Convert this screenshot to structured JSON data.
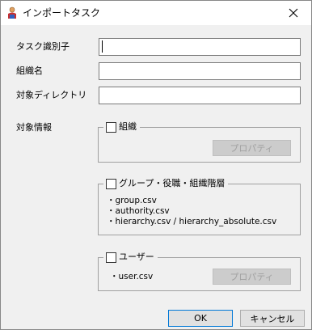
{
  "window": {
    "title": "インポートタスク"
  },
  "form": {
    "task_id_label": "タスク識別子",
    "task_id_value": "",
    "org_name_label": "組織名",
    "org_name_value": "",
    "target_dir_label": "対象ディレクトリ",
    "target_dir_value": "",
    "target_info_label": "対象情報"
  },
  "groups": {
    "organization": {
      "label": "組織",
      "checked": false,
      "properties_label": "プロパティ"
    },
    "group_role": {
      "label": "グループ・役職・組織階層",
      "checked": false,
      "files": [
        "・group.csv",
        "・authority.csv",
        "・hierarchy.csv / hierarchy_absolute.csv"
      ]
    },
    "user": {
      "label": "ユーザー",
      "checked": false,
      "files": [
        "・user.csv"
      ],
      "properties_label": "プロパティ"
    }
  },
  "footer": {
    "ok_label": "OK",
    "cancel_label": "キャンセル"
  }
}
